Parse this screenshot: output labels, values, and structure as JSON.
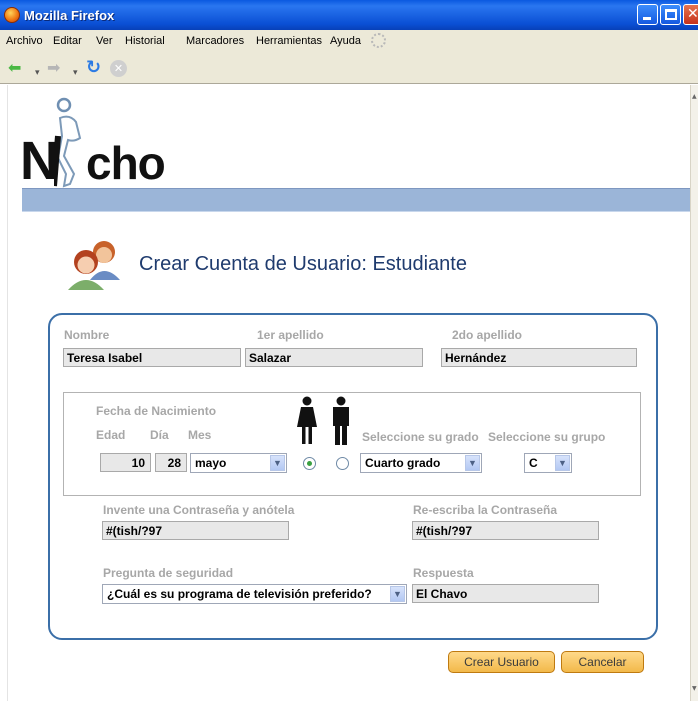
{
  "window": {
    "title": "Mozilla Firefox"
  },
  "menu": [
    "Archivo",
    "Editar",
    "Ver",
    "Historial",
    "Marcadores",
    "Herramientas",
    "Ayuda"
  ],
  "logo": {
    "letter": "N",
    "rest": "cho"
  },
  "page": {
    "title": "Crear Cuenta de Usuario: Estudiante"
  },
  "form": {
    "nombre_label": "Nombre",
    "nombre_value": "Teresa Isabel",
    "apellido1_label": "1er apellido",
    "apellido1_value": "Salazar",
    "apellido2_label": "2do apellido",
    "apellido2_value": "Hernández",
    "birth_label": "Fecha de Nacimiento",
    "edad_label": "Edad",
    "dia_label": "Día",
    "mes_label": "Mes",
    "edad_value": "10",
    "dia_value": "28",
    "mes_value": "mayo",
    "sex_selected": "female",
    "grado_label": "Seleccione su grado",
    "grado_value": "Cuarto grado",
    "grupo_label": "Seleccione su grupo",
    "grupo_value": "C",
    "password_label": "Invente una Contraseña y anótela",
    "password_value": "#(tish/?97",
    "password2_label": "Re-escriba la Contraseña",
    "password2_value": "#(tish/?97",
    "question_label": "Pregunta de seguridad",
    "question_value": "¿Cuál es su programa de televisión preferido?",
    "answer_label": "Respuesta",
    "answer_value": "El Chavo"
  },
  "buttons": {
    "create": "Crear Usuario",
    "cancel": "Cancelar"
  },
  "colors": {
    "panel_border": "#3b6fa8",
    "bluebar": "#9bb5d8",
    "button": "#f2b94a"
  }
}
